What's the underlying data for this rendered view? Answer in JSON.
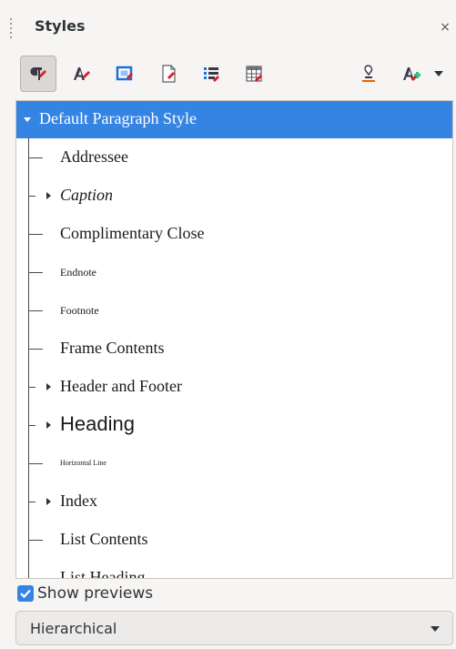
{
  "deck": {
    "title": "Styles",
    "close_glyph": "×"
  },
  "toolbar": {
    "buttons": [
      {
        "name": "paragraph-styles-button",
        "icon": "paragraph-styles-icon",
        "active": true
      },
      {
        "name": "character-styles-button",
        "icon": "character-styles-icon",
        "active": false
      },
      {
        "name": "frame-styles-button",
        "icon": "frame-styles-icon",
        "active": false
      },
      {
        "name": "page-styles-button",
        "icon": "page-styles-icon",
        "active": false
      },
      {
        "name": "list-styles-button",
        "icon": "list-styles-icon",
        "active": false
      },
      {
        "name": "table-styles-button",
        "icon": "table-styles-icon",
        "active": false
      },
      {
        "name": "fill-format-mode-button",
        "icon": "fill-format-icon",
        "active": false
      },
      {
        "name": "new-style-from-selection-button",
        "icon": "new-style-icon",
        "active": false
      },
      {
        "name": "style-actions-dropdown-button",
        "icon": "chevron-down-icon",
        "active": false
      }
    ]
  },
  "tree": {
    "root": {
      "label": "Default Paragraph Style",
      "expanded": true,
      "selected": true
    },
    "items": [
      {
        "label": "Addressee",
        "has_children": false
      },
      {
        "label": "Caption",
        "has_children": true
      },
      {
        "label": "Complimentary Close",
        "has_children": false
      },
      {
        "label": "Endnote",
        "has_children": false
      },
      {
        "label": "Footnote",
        "has_children": false
      },
      {
        "label": "Frame Contents",
        "has_children": false
      },
      {
        "label": "Header and Footer",
        "has_children": true
      },
      {
        "label": "Heading",
        "has_children": true
      },
      {
        "label": "Horizontal Line",
        "has_children": false
      },
      {
        "label": "Index",
        "has_children": true
      },
      {
        "label": "List Contents",
        "has_children": false
      },
      {
        "label": "List Heading",
        "has_children": false
      }
    ]
  },
  "show_previews": {
    "label": "Show previews",
    "checked": true
  },
  "filter": {
    "selected": "Hierarchical"
  },
  "colors": {
    "accent": "#3584e4",
    "background": "#f6f5f4"
  }
}
